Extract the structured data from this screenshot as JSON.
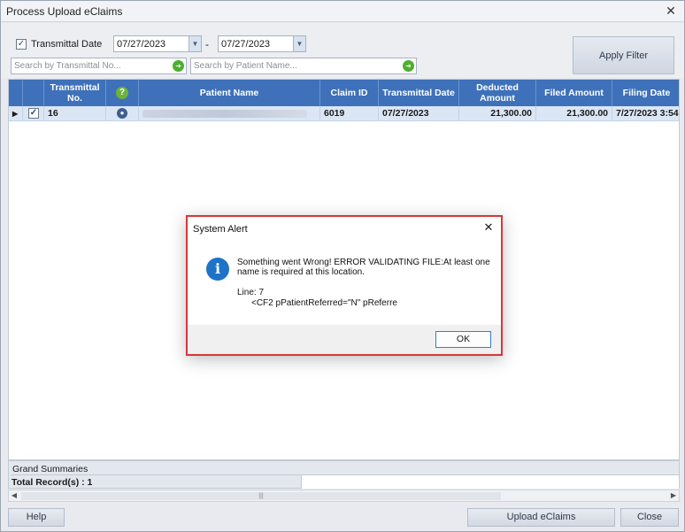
{
  "window": {
    "title": "Process Upload eClaims",
    "close_glyph": "✕"
  },
  "filter": {
    "transmittal_date_label": "Transmittal Date",
    "transmittal_date_checked": true,
    "date_from": "07/27/2023",
    "date_separator": "-",
    "date_to": "07/27/2023",
    "search_transmittal_placeholder": "Search by Transmittal No...",
    "search_patient_placeholder": "Search by Patient Name...",
    "apply_filter_label": "Apply Filter"
  },
  "grid": {
    "columns": [
      {
        "label": ""
      },
      {
        "label": ""
      },
      {
        "label": "Transmittal No."
      },
      {
        "label": "?"
      },
      {
        "label": "Patient Name"
      },
      {
        "label": "Claim ID"
      },
      {
        "label": "Transmittal Date"
      },
      {
        "label": "Deducted Amount"
      },
      {
        "label": "Filed Amount"
      },
      {
        "label": "Filing Date"
      }
    ],
    "rows": [
      {
        "selected": true,
        "transmittal_no": "16",
        "patient_name": "",
        "claim_id": "6019",
        "transmittal_date": "07/27/2023",
        "deducted_amount": "21,300.00",
        "filed_amount": "21,300.00",
        "filing_date": "7/27/2023  3:54:"
      }
    ]
  },
  "summary": {
    "grand_summaries_label": "Grand Summaries",
    "total_records_label": "Total Record(s) : 1"
  },
  "buttons": {
    "help": "Help",
    "upload": "Upload eClaims",
    "close": "Close"
  },
  "alert": {
    "title": "System Alert",
    "icon_letter": "i",
    "message": "Something went Wrong! ERROR VALIDATING FILE:At least one name is required at this location.",
    "line_label": "Line: 7",
    "line_code": "<CF2 pPatientReferred=\"N\" pReferre",
    "ok_label": "OK"
  },
  "colors": {
    "header_blue": "#3e71b9",
    "row_selected": "#dbe6f5",
    "alert_border": "#d9363a",
    "info_icon": "#1e73c8",
    "search_go": "#4caf2f",
    "help_icon": "#6cb33e"
  }
}
